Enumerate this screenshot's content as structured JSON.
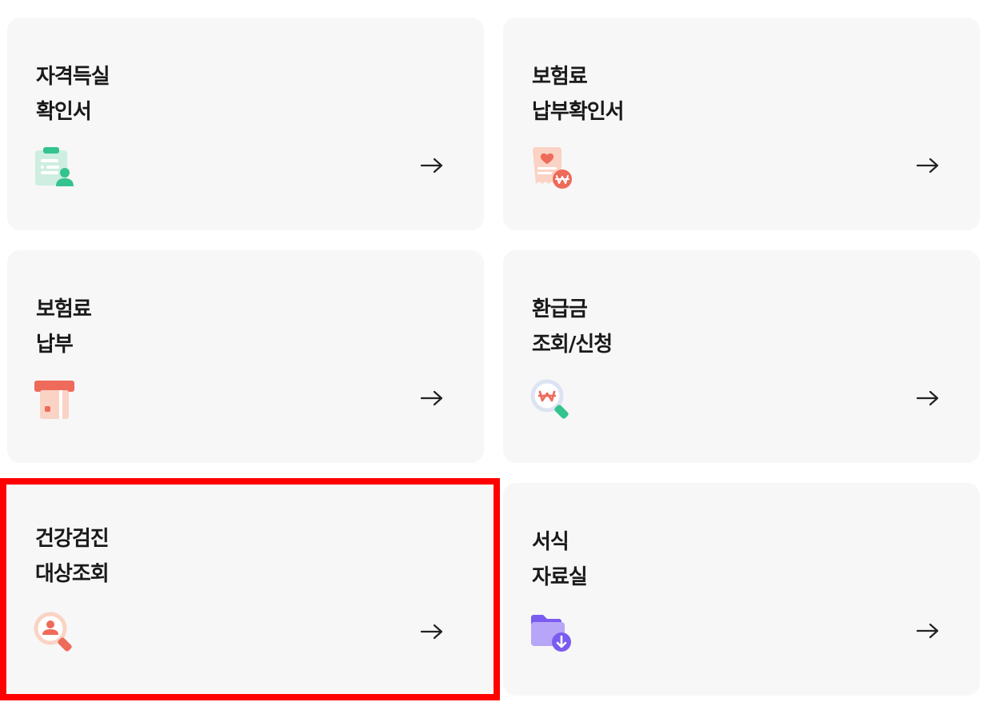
{
  "cards": [
    {
      "line1": "자격득실",
      "line2": "확인서",
      "icon": "certificate-person-icon",
      "arrow": "arrow-right-icon"
    },
    {
      "line1": "보험료",
      "line2": "납부확인서",
      "icon": "receipt-won-icon",
      "arrow": "arrow-right-icon"
    },
    {
      "line1": "보험료",
      "line2": "납부",
      "icon": "card-payment-icon",
      "arrow": "arrow-right-icon"
    },
    {
      "line1": "환급금",
      "line2": "조회/신청",
      "icon": "magnifier-won-icon",
      "arrow": "arrow-right-icon"
    },
    {
      "line1": "건강검진",
      "line2": "대상조회",
      "icon": "magnifier-person-icon",
      "arrow": "arrow-right-icon",
      "selected": true
    },
    {
      "line1": "서식",
      "line2": "자료실",
      "icon": "folder-download-icon",
      "arrow": "arrow-right-icon"
    }
  ],
  "colors": {
    "card_bg": "#f7f7f7",
    "highlight": "#ff0000",
    "green": "#34c38f",
    "coral": "#ee6a5a",
    "peach": "#fad3c4",
    "purple": "#7b5cf0"
  }
}
